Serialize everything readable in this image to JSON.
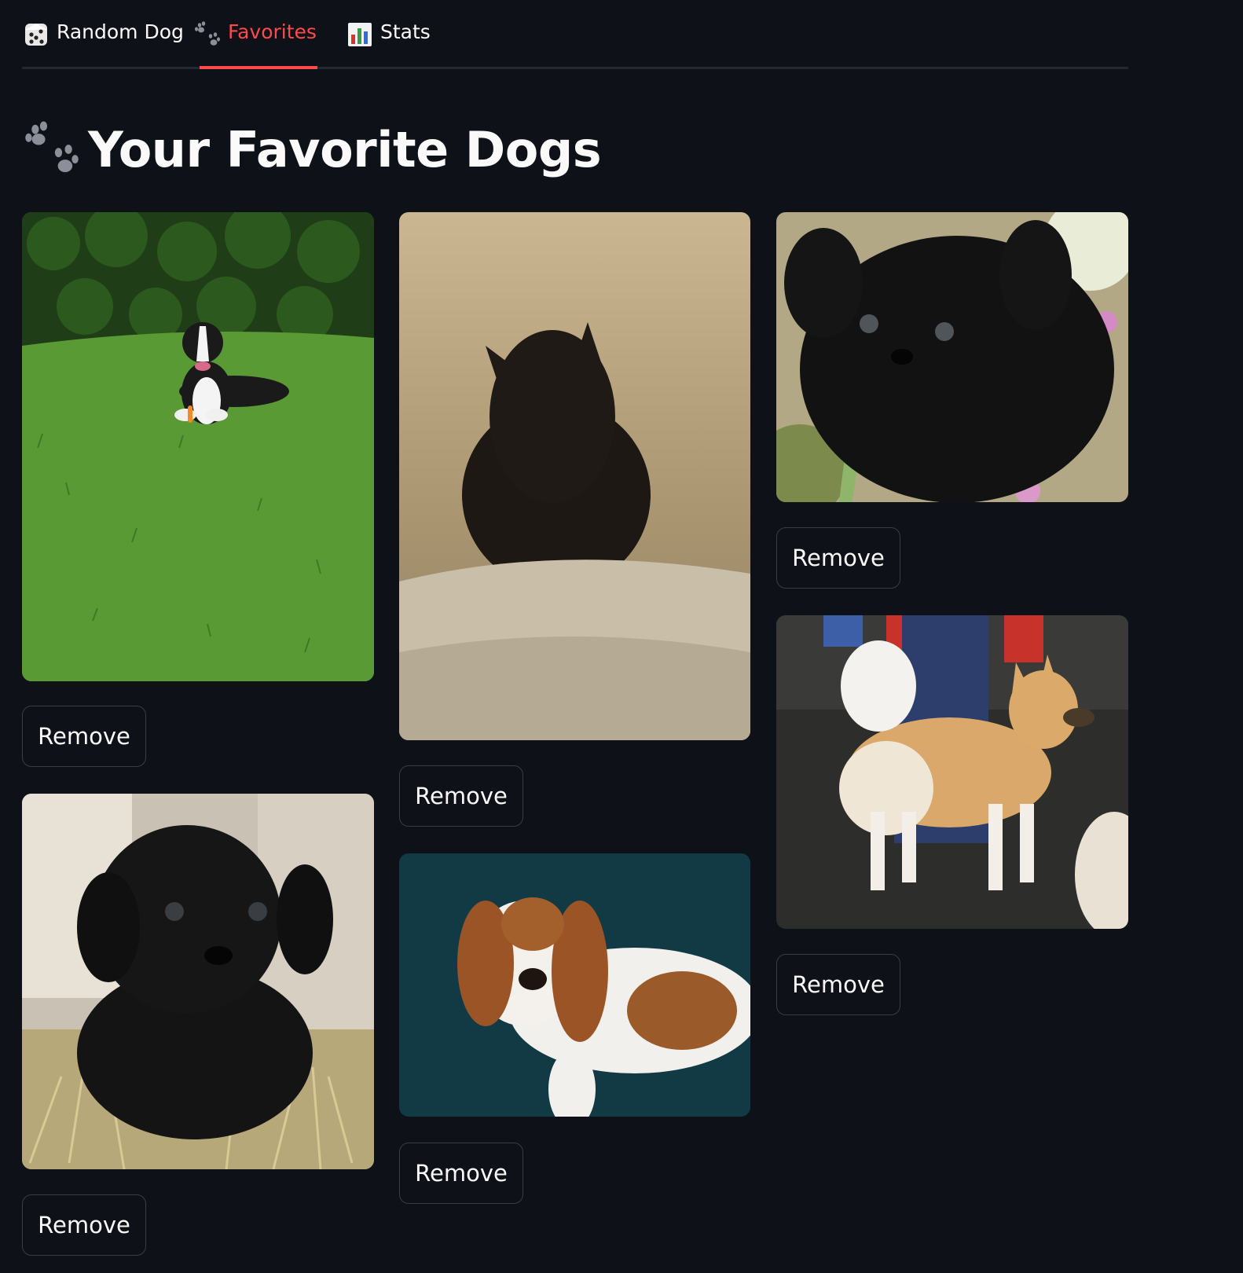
{
  "tabs": [
    {
      "label": "Random Dog",
      "icon": "dice-icon",
      "active": false
    },
    {
      "label": "Favorites",
      "icon": "paw-prints-icon",
      "active": true
    },
    {
      "label": "Stats",
      "icon": "bar-chart-icon",
      "active": false
    }
  ],
  "page_title": "Your Favorite Dogs",
  "title_icon": "paw-prints-icon",
  "accent_color": "#ff4b4b",
  "favorites": [
    {
      "photo": "dog-photo-black-white-in-grass",
      "remove_label": "Remove"
    },
    {
      "photo": "dog-photo-black-griffon",
      "remove_label": "Remove"
    },
    {
      "photo": "dog-photo-black-fluffy-puppy",
      "remove_label": "Remove"
    },
    {
      "photo": "dog-photo-black-puppy-in-straw",
      "remove_label": "Remove"
    },
    {
      "photo": "dog-photo-basset-hound-puppy",
      "remove_label": "Remove"
    },
    {
      "photo": "dog-photo-tan-spitz",
      "remove_label": "Remove"
    }
  ]
}
